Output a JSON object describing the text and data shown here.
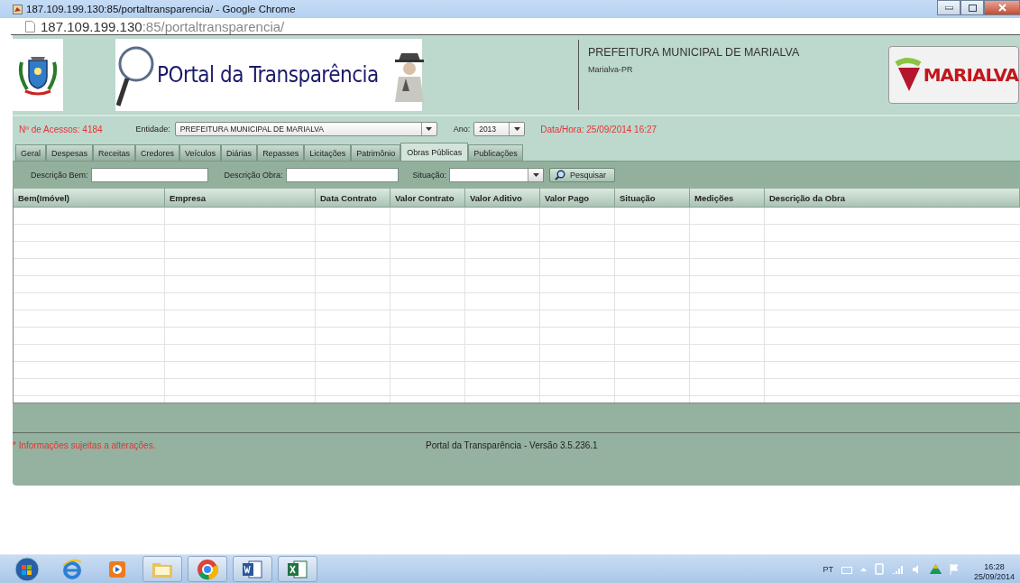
{
  "browser": {
    "title": "187.109.199.130:85/portaltransparencia/ - Google Chrome",
    "url_host": "187.109.199.130",
    "url_path": ":85/portaltransparencia/"
  },
  "header": {
    "logo_text": "POrtal da Transparência",
    "org_name": "PREFEITURA MUNICIPAL DE MARIALVA",
    "org_city": "Marialva-PR",
    "brand_text": "MARIALVA"
  },
  "info": {
    "access_count": "Nº de Acessos: 4184",
    "entity_label": "Entidade:",
    "entity_value": "PREFEITURA MUNICIPAL DE MARIALVA",
    "year_label": "Ano:",
    "year_value": "2013",
    "datetime": "Data/Hora: 25/09/2014 16:27"
  },
  "tabs": [
    {
      "label": "Geral",
      "selected": false
    },
    {
      "label": "Despesas",
      "selected": false
    },
    {
      "label": "Receitas",
      "selected": false
    },
    {
      "label": "Credores",
      "selected": false
    },
    {
      "label": "Veículos",
      "selected": false
    },
    {
      "label": "Diárias",
      "selected": false
    },
    {
      "label": "Repasses",
      "selected": false
    },
    {
      "label": "Licitações",
      "selected": false
    },
    {
      "label": "Patrimônio",
      "selected": false
    },
    {
      "label": "Obras Públicas",
      "selected": true
    },
    {
      "label": "Publicações",
      "selected": false
    }
  ],
  "filters": [
    {
      "label": "Descrição Bem:",
      "kind": "text"
    },
    {
      "label": "Descrição Obra:",
      "kind": "text"
    },
    {
      "label": "Situação:",
      "kind": "select"
    }
  ],
  "search_button": "Pesquisar",
  "table": {
    "columns": [
      "Bem(Imóvel)",
      "Empresa",
      "Data Contrato",
      "Valor Contrato",
      "Valor Aditivo",
      "Valor Pago",
      "Situação",
      "Medições",
      "Descrição da Obra"
    ]
  },
  "footer": {
    "note": "* Informações sujeitas a alterações.",
    "version": "Portal da Transparência - Versão 3.5.236.1"
  },
  "taskbar": {
    "language": "PT",
    "time": "16:28",
    "date": "25/09/2014"
  }
}
